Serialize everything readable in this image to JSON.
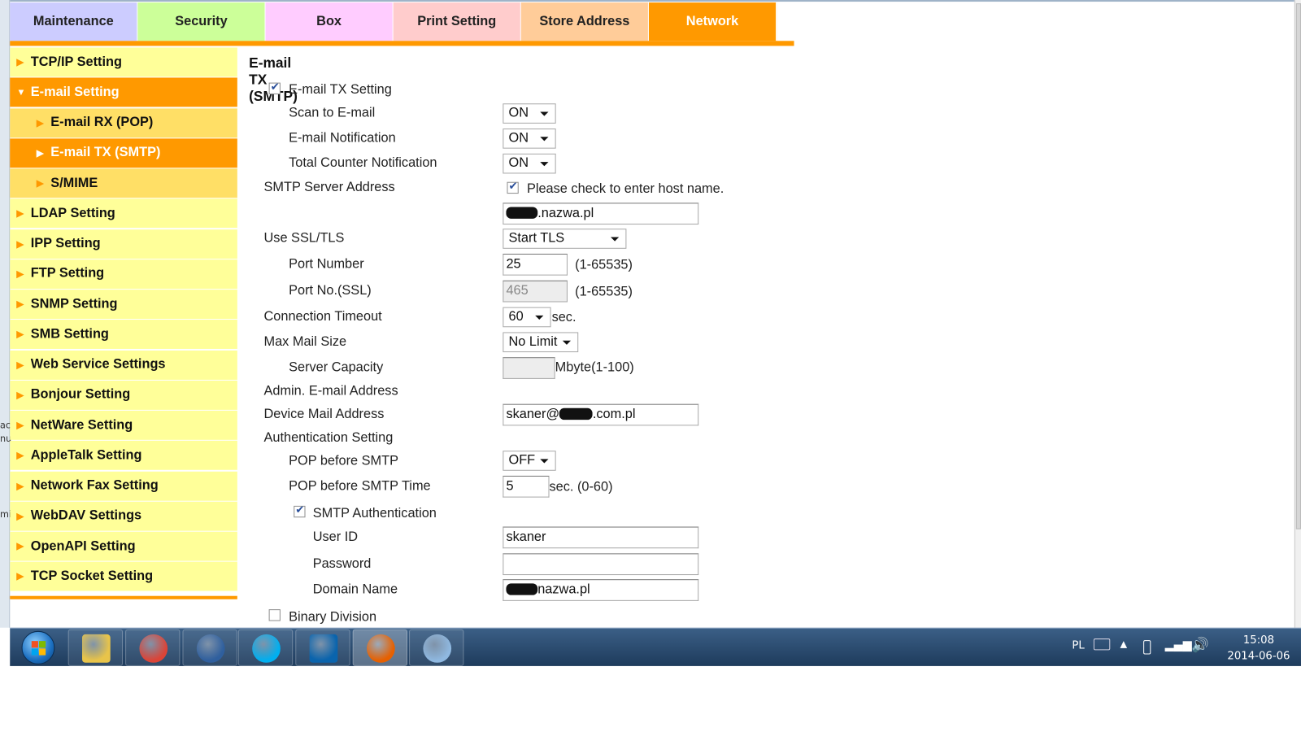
{
  "tabs": [
    {
      "label": "Maintenance",
      "color": "#ccccff"
    },
    {
      "label": "Security",
      "color": "#ccff99"
    },
    {
      "label": "Box",
      "color": "#ffccff"
    },
    {
      "label": "Print Setting",
      "color": "#ffcccc"
    },
    {
      "label": "Store Address",
      "color": "#ffcc99"
    },
    {
      "label": "Network",
      "color": "#ff9900",
      "active": true
    }
  ],
  "sidebar": {
    "items": [
      {
        "label": "TCP/IP Setting"
      },
      {
        "label": "E-mail Setting",
        "expanded": true,
        "active": true
      },
      {
        "label": "E-mail RX (POP)",
        "sub": true
      },
      {
        "label": "E-mail TX (SMTP)",
        "sub": true,
        "active": true
      },
      {
        "label": "S/MIME",
        "sub": true
      },
      {
        "label": "LDAP Setting"
      },
      {
        "label": "IPP Setting"
      },
      {
        "label": "FTP Setting"
      },
      {
        "label": "SNMP Setting"
      },
      {
        "label": "SMB Setting"
      },
      {
        "label": "Web Service Settings"
      },
      {
        "label": "Bonjour Setting"
      },
      {
        "label": "NetWare Setting"
      },
      {
        "label": "AppleTalk Setting"
      },
      {
        "label": "Network Fax Setting"
      },
      {
        "label": "WebDAV Settings"
      },
      {
        "label": "OpenAPI Setting"
      },
      {
        "label": "TCP Socket Setting"
      }
    ]
  },
  "form": {
    "title": "E-mail TX (SMTP)",
    "email_tx_setting": {
      "label": "E-mail TX Setting",
      "checked": true
    },
    "scan_to_email": {
      "label": "Scan to E-mail",
      "value": "ON"
    },
    "email_notification": {
      "label": "E-mail Notification",
      "value": "ON"
    },
    "total_counter_notification": {
      "label": "Total Counter Notification",
      "value": "ON"
    },
    "smtp_server": {
      "label": "SMTP Server Address",
      "check_label": "Please check to enter host name.",
      "checked": true,
      "value_suffix": ".nazwa.pl"
    },
    "ssl_tls": {
      "label": "Use SSL/TLS",
      "value": "Start TLS"
    },
    "port_number": {
      "label": "Port Number",
      "value": "25",
      "range": "(1-65535)"
    },
    "port_ssl": {
      "label": "Port No.(SSL)",
      "value": "465",
      "range": "(1-65535)"
    },
    "connection_timeout": {
      "label": "Connection Timeout",
      "value": "60",
      "unit": "sec."
    },
    "max_mail_size": {
      "label": "Max Mail Size",
      "value": "No Limit"
    },
    "server_capacity": {
      "label": "Server Capacity",
      "value": "",
      "unit": "Mbyte(1-100)"
    },
    "admin_email": {
      "label": "Admin. E-mail Address"
    },
    "device_mail": {
      "label": "Device Mail Address",
      "value_prefix": "skaner@",
      "value_suffix": ".com.pl"
    },
    "auth_setting": {
      "label": "Authentication Setting"
    },
    "pop_before_smtp": {
      "label": "POP before SMTP",
      "value": "OFF"
    },
    "pop_before_smtp_time": {
      "label": "POP before SMTP Time",
      "value": "5",
      "unit": "sec. (0-60)"
    },
    "smtp_auth": {
      "label": "SMTP Authentication",
      "checked": true
    },
    "user_id": {
      "label": "User ID",
      "value": "skaner"
    },
    "password": {
      "label": "Password",
      "value": ""
    },
    "domain_name": {
      "label": "Domain Name",
      "value_suffix": "nazwa.pl"
    },
    "binary_division": {
      "label": "Binary Division",
      "checked": false
    }
  },
  "background_window": {
    "fragments": [
      "ac",
      "nu",
      "mi"
    ]
  },
  "taskbar": {
    "apps": [
      {
        "name": "file-explorer-icon",
        "color": "#e8c44a"
      },
      {
        "name": "chrome-icon",
        "color": "#db4437"
      },
      {
        "name": "thunderbird-icon",
        "color": "#2f5f9e"
      },
      {
        "name": "skype-icon",
        "color": "#00aff0"
      },
      {
        "name": "outlook-icon",
        "color": "#0a64ad"
      },
      {
        "name": "firefox-icon",
        "color": "#e66000",
        "active": true
      },
      {
        "name": "paint-icon",
        "color": "#8fb8e0"
      }
    ],
    "language": "PL",
    "time": "15:08",
    "date": "2014-06-06"
  }
}
